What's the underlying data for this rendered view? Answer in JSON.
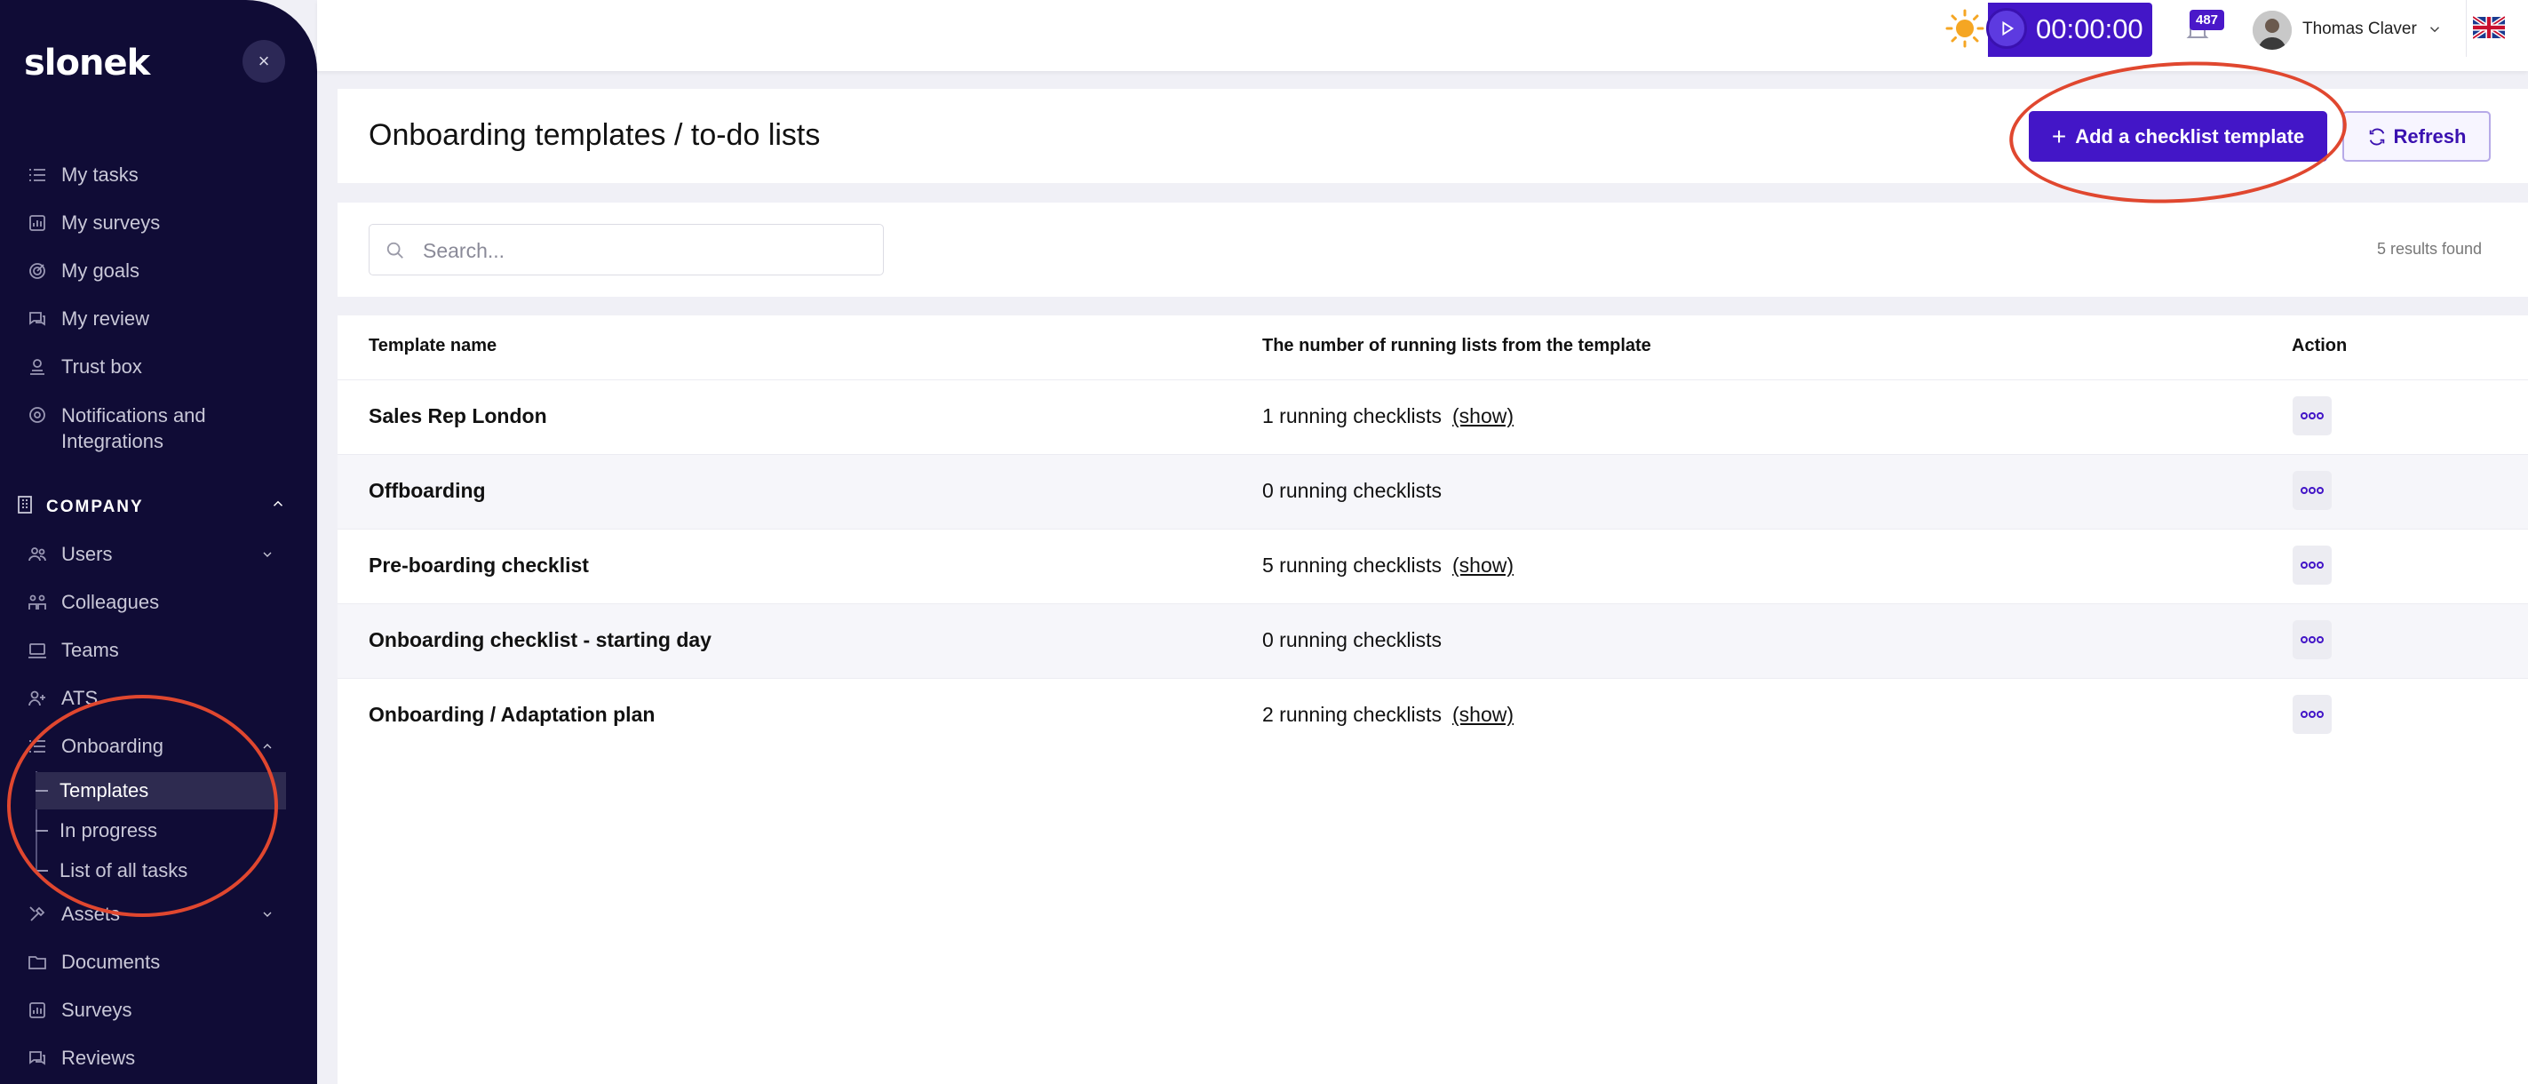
{
  "sidebar": {
    "logo": "slonek",
    "close_label": "×",
    "items": [
      {
        "label": "My tasks",
        "icon": "tasks-icon"
      },
      {
        "label": "My surveys",
        "icon": "survey-icon"
      },
      {
        "label": "My goals",
        "icon": "goals-icon"
      },
      {
        "label": "My review",
        "icon": "review-icon"
      },
      {
        "label": "Trust box",
        "icon": "trust-box-icon"
      },
      {
        "label": "Notifications and",
        "label2": "Integrations",
        "icon": "gear-icon"
      }
    ],
    "company_header": "COMPANY",
    "company_items": [
      {
        "label": "Users",
        "icon": "users-icon"
      },
      {
        "label": "Colleagues",
        "icon": "colleagues-icon"
      },
      {
        "label": "Teams",
        "icon": "teams-icon"
      },
      {
        "label": "ATS",
        "icon": "ats-icon"
      },
      {
        "label": "Onboarding",
        "icon": "onboarding-icon"
      },
      {
        "label": "Assets",
        "icon": "assets-icon"
      },
      {
        "label": "Documents",
        "icon": "folder-icon"
      },
      {
        "label": "Surveys",
        "icon": "survey-icon"
      },
      {
        "label": "Reviews",
        "icon": "review-icon"
      }
    ],
    "onboarding_sub": [
      "Templates",
      "In progress",
      "List of all tasks"
    ]
  },
  "topbar": {
    "timer": "00:00:00",
    "notification_count": "487",
    "user_name": "Thomas Claver"
  },
  "header": {
    "title": "Onboarding templates / to-do lists",
    "add_button": "Add a checklist template",
    "add_plus": "+",
    "refresh_button": "Refresh"
  },
  "search": {
    "placeholder": "Search...",
    "results": "5 results found"
  },
  "table": {
    "columns": [
      "Template name",
      "The number of running lists from the template",
      "Action"
    ],
    "rows": [
      {
        "name": "Sales Rep London",
        "count": "1 running checklists",
        "show": "(show)"
      },
      {
        "name": "Offboarding",
        "count": "0 running checklists",
        "show": ""
      },
      {
        "name": "Pre-boarding checklist",
        "count": "5 running checklists",
        "show": "(show)"
      },
      {
        "name": "Onboarding checklist - starting day",
        "count": "0 running checklists",
        "show": ""
      },
      {
        "name": "Onboarding / Adaptation plan",
        "count": "2 running checklists",
        "show": "(show)"
      }
    ]
  },
  "colors": {
    "sidebar_bg": "#100c36",
    "primary": "#4316c7",
    "annotation": "#e0472f"
  }
}
